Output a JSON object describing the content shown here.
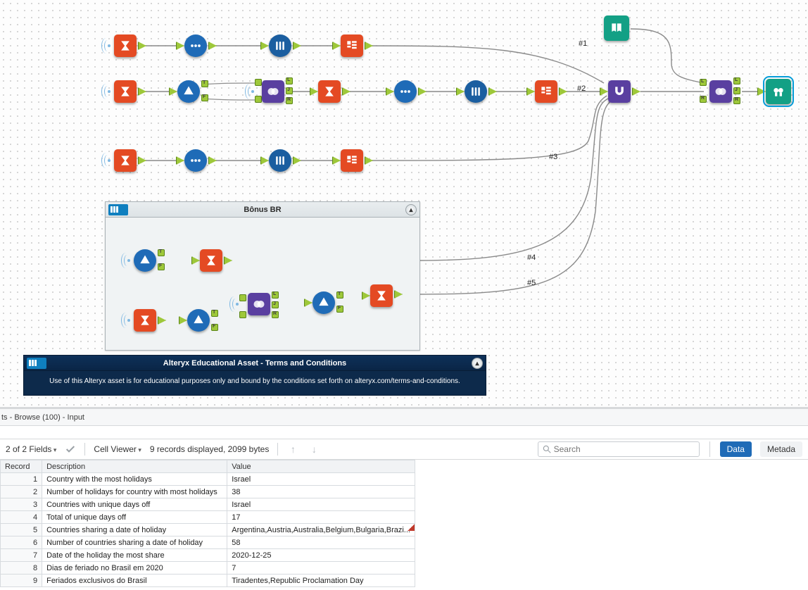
{
  "canvas": {
    "bonus_title": "Bônus BR",
    "terms_title": "Alteryx Educational Asset - Terms and Conditions",
    "terms_body": "Use of this Alteryx asset is for educational purposes only and bound by the conditions set forth on alteryx.com/terms-and-conditions.",
    "wire_labels": {
      "w1": "#1",
      "w2": "#2",
      "w3": "#3",
      "w4": "#4",
      "w5": "#5"
    },
    "ports": {
      "L": "L",
      "J": "J",
      "R": "R",
      "T": "T",
      "F": "F"
    }
  },
  "results": {
    "title": "ts - Browse (100) - Input",
    "fields_label": "2 of 2 Fields",
    "cellviewer_label": "Cell Viewer",
    "records_label": "9 records displayed, 2099 bytes",
    "search_placeholder": "Search",
    "tab_data": "Data",
    "tab_meta": "Metada",
    "columns": {
      "record": "Record",
      "description": "Description",
      "value": "Value"
    },
    "rows": [
      {
        "n": "1",
        "d": "Country with the most holidays",
        "v": "Israel"
      },
      {
        "n": "2",
        "d": "Number of holidays for country with most holidays",
        "v": "38"
      },
      {
        "n": "3",
        "d": "Countries with unique days off",
        "v": "Israel"
      },
      {
        "n": "4",
        "d": "Total of unique days off",
        "v": "17"
      },
      {
        "n": "5",
        "d": "Countries sharing a date of holiday",
        "v": "Argentina,Austria,Australia,Belgium,Bulgaria,Brazi..."
      },
      {
        "n": "6",
        "d": "Number of countries sharing a date of holiday",
        "v": "58"
      },
      {
        "n": "7",
        "d": "Date of the holiday the most share",
        "v": "2020-12-25"
      },
      {
        "n": "8",
        "d": "Dias de feriado no Brasil em 2020",
        "v": "7"
      },
      {
        "n": "9",
        "d": "Feriados exclusivos do Brasil",
        "v": "Tiradentes,Republic Proclamation Day"
      }
    ]
  }
}
